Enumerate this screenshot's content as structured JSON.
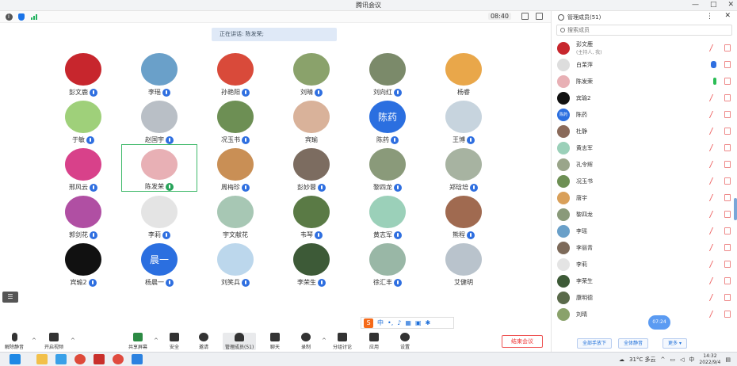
{
  "window": {
    "title": "腾讯会议",
    "min": "—",
    "max": "□",
    "close": "✕"
  },
  "topbar": {
    "timer": "08:40"
  },
  "speaking": "正在讲话: 陈发荣;",
  "grid": {
    "tiles": [
      {
        "name": "彭文鹿",
        "color": "#c7262d",
        "text": "",
        "mic": "blue"
      },
      {
        "name": "李瑶",
        "color": "#6aa0c9",
        "text": "",
        "mic": "blue"
      },
      {
        "name": "孙艳阳",
        "color": "#d94a3a",
        "text": "",
        "mic": "blue"
      },
      {
        "name": "刘晴",
        "color": "#8aa26b",
        "text": "",
        "mic": "blue"
      },
      {
        "name": "刘向红",
        "color": "#7b8a6a",
        "text": "",
        "mic": "blue"
      },
      {
        "name": "杨睿",
        "color": "#e9a74a",
        "text": "",
        "mic": "none"
      },
      {
        "name": "于敏",
        "color": "#9fd07a",
        "text": "",
        "mic": "blue"
      },
      {
        "name": "赵国宇",
        "color": "#b9bfc6",
        "text": "",
        "mic": "blue"
      },
      {
        "name": "况玉书",
        "color": "#6d8f54",
        "text": "",
        "mic": "blue"
      },
      {
        "name": "宾瑜",
        "color": "#d9b29a",
        "text": "",
        "mic": "none"
      },
      {
        "name": "陈药",
        "color": "#2b6fe0",
        "text": "陈药",
        "mic": "blue"
      },
      {
        "name": "王博",
        "color": "#c7d4de",
        "text": "",
        "mic": "blue"
      },
      {
        "name": "邢风云",
        "color": "#d8418a",
        "text": "",
        "mic": "blue"
      },
      {
        "name": "陈发荣",
        "color": "#e8b0b5",
        "text": "",
        "mic": "green"
      },
      {
        "name": "周梅珍",
        "color": "#c98f55",
        "text": "",
        "mic": "blue"
      },
      {
        "name": "彭妙蓉",
        "color": "#7c6c60",
        "text": "",
        "mic": "blue"
      },
      {
        "name": "黎四龙",
        "color": "#8a9a7a",
        "text": "",
        "mic": "blue"
      },
      {
        "name": "郑琀培",
        "color": "#a7b3a1",
        "text": "",
        "mic": "blue"
      },
      {
        "name": "郭剑花",
        "color": "#b04fa3",
        "text": "",
        "mic": "blue"
      },
      {
        "name": "李莉",
        "color": "#e4e4e4",
        "text": "",
        "mic": "blue"
      },
      {
        "name": "宇文献花",
        "color": "#a7c7b4",
        "text": "",
        "mic": "none"
      },
      {
        "name": "韦琴",
        "color": "#5a7a45",
        "text": "",
        "mic": "blue"
      },
      {
        "name": "黄志军",
        "color": "#9bd0b9",
        "text": "",
        "mic": "blue"
      },
      {
        "name": "熊程",
        "color": "#a06a50",
        "text": "",
        "mic": "blue"
      },
      {
        "name": "宾瑜2",
        "color": "#111111",
        "text": "",
        "mic": "blue"
      },
      {
        "name": "杨晨一",
        "color": "#2b6fe0",
        "text": "晨一",
        "mic": "blue"
      },
      {
        "name": "刘笑兵",
        "color": "#bcd7ec",
        "text": "",
        "mic": "blue"
      },
      {
        "name": "李荣生",
        "color": "#3d5a37",
        "text": "",
        "mic": "blue"
      },
      {
        "name": "徐汇丰",
        "color": "#99b7a6",
        "text": "",
        "mic": "blue"
      },
      {
        "name": "艾健明",
        "color": "#b9c3cc",
        "text": "",
        "mic": "none"
      }
    ]
  },
  "toolbar": {
    "mute": "解除静音",
    "video": "开启视频",
    "share": "共享屏幕",
    "security": "安全",
    "invite": "邀请",
    "members": "管理成员(51)",
    "chat": "聊天",
    "record": "录制",
    "breakout": "分组讨论",
    "apps": "应用",
    "settings": "设置",
    "end": "结束会议"
  },
  "ime": {
    "logo": "S",
    "lang": "中"
  },
  "panel": {
    "title": "管理成员(51)",
    "search_placeholder": "搜索成员",
    "members": [
      {
        "name": "彭文鹿",
        "sub": "(主持人, 我)",
        "color": "#c7262d",
        "t": "",
        "r1": "mic-off"
      },
      {
        "name": "白茉萍",
        "sub": "",
        "color": "#dddddd",
        "t": "",
        "r1": "hand"
      },
      {
        "name": "陈发荣",
        "sub": "",
        "color": "#e8b0b5",
        "t": "",
        "r1": "mic-on"
      },
      {
        "name": "宾瑜2",
        "sub": "",
        "color": "#111111",
        "t": "",
        "r1": "mic-off"
      },
      {
        "name": "陈药",
        "sub": "",
        "color": "#2b6fe0",
        "t": "陈药",
        "r1": "mic-off"
      },
      {
        "name": "杜静",
        "sub": "",
        "color": "#8a6a5a",
        "t": "",
        "r1": "mic-off"
      },
      {
        "name": "黄志军",
        "sub": "",
        "color": "#9bd0b9",
        "t": "",
        "r1": "mic-off"
      },
      {
        "name": "孔令辉",
        "sub": "",
        "color": "#9aa58a",
        "t": "",
        "r1": "mic-off"
      },
      {
        "name": "况玉书",
        "sub": "",
        "color": "#6d8f54",
        "t": "",
        "r1": "mic-off"
      },
      {
        "name": "唐宇",
        "sub": "",
        "color": "#d9a05a",
        "t": "",
        "r1": "mic-off"
      },
      {
        "name": "黎四龙",
        "sub": "",
        "color": "#8a9a7a",
        "t": "",
        "r1": "mic-off"
      },
      {
        "name": "李瑶",
        "sub": "",
        "color": "#6aa0c9",
        "t": "",
        "r1": "mic-off"
      },
      {
        "name": "李丽青",
        "sub": "",
        "color": "#7d6a5a",
        "t": "",
        "r1": "mic-off"
      },
      {
        "name": "李莉",
        "sub": "",
        "color": "#e4e4e4",
        "t": "",
        "r1": "mic-off"
      },
      {
        "name": "李荣生",
        "sub": "",
        "color": "#3d5a37",
        "t": "",
        "r1": "mic-off"
      },
      {
        "name": "康明德",
        "sub": "",
        "color": "#5a6a4a",
        "t": "",
        "r1": "mic-off"
      },
      {
        "name": "刘晴",
        "sub": "",
        "color": "#8aa26b",
        "t": "",
        "r1": "mic-off"
      }
    ],
    "bubble": "07:24",
    "btn_mute_all_hands": "全部手放下",
    "btn_mute_all": "全体静音",
    "btn_more": "更多 ▾"
  },
  "taskbar": {
    "weather": "31°C 多云",
    "time": "14:32",
    "date": "2022/9/4",
    "ime": "中"
  }
}
